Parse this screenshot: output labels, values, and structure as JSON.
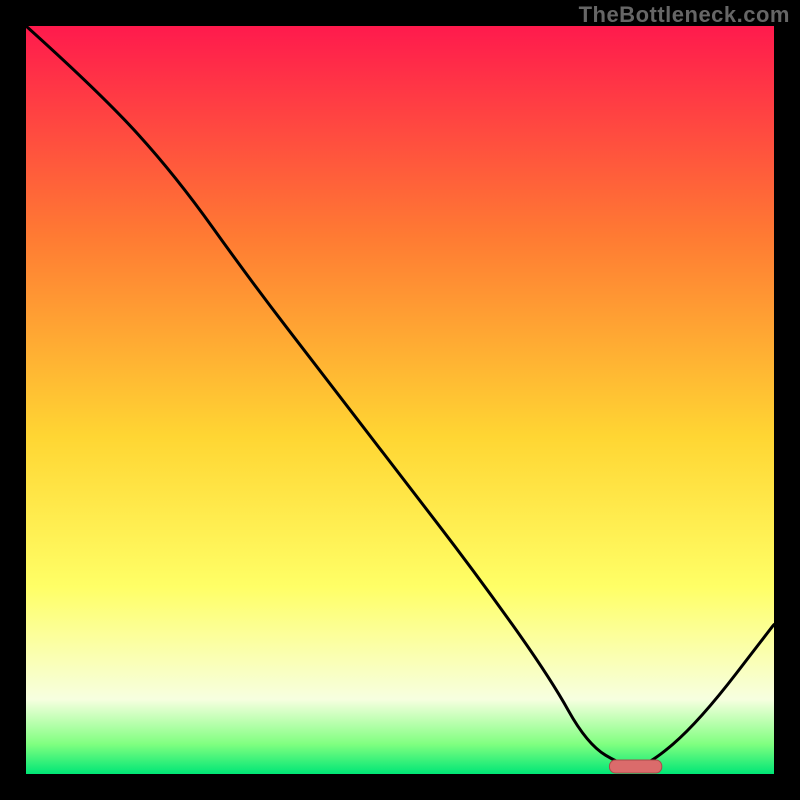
{
  "watermark": "TheBottleneck.com",
  "colors": {
    "frame": "#000000",
    "curve": "#000000",
    "marker_fill": "#db6b6b",
    "marker_stroke": "#a94b4b",
    "gradient": {
      "top": "#ff1a4d",
      "upper_mid": "#ff7a33",
      "mid": "#ffd633",
      "lower_mid": "#ffff66",
      "pale": "#f7ffe0",
      "near_bottom": "#80ff80",
      "bottom": "#00e676"
    }
  },
  "chart_data": {
    "type": "line",
    "title": "",
    "xlabel": "",
    "ylabel": "",
    "xlim": [
      0,
      100
    ],
    "ylim": [
      0,
      100
    ],
    "x": [
      0,
      10,
      20,
      30,
      40,
      50,
      60,
      70,
      75,
      80,
      83,
      90,
      100
    ],
    "values": [
      100,
      91,
      80,
      66,
      53,
      40,
      27,
      13,
      4,
      1,
      1,
      7,
      20
    ],
    "flat_region": {
      "x_start": 77,
      "x_end": 85,
      "y": 1
    },
    "marker": {
      "x_start": 78,
      "x_end": 85,
      "y": 1
    },
    "annotations": [],
    "grid": false,
    "legend": null
  }
}
